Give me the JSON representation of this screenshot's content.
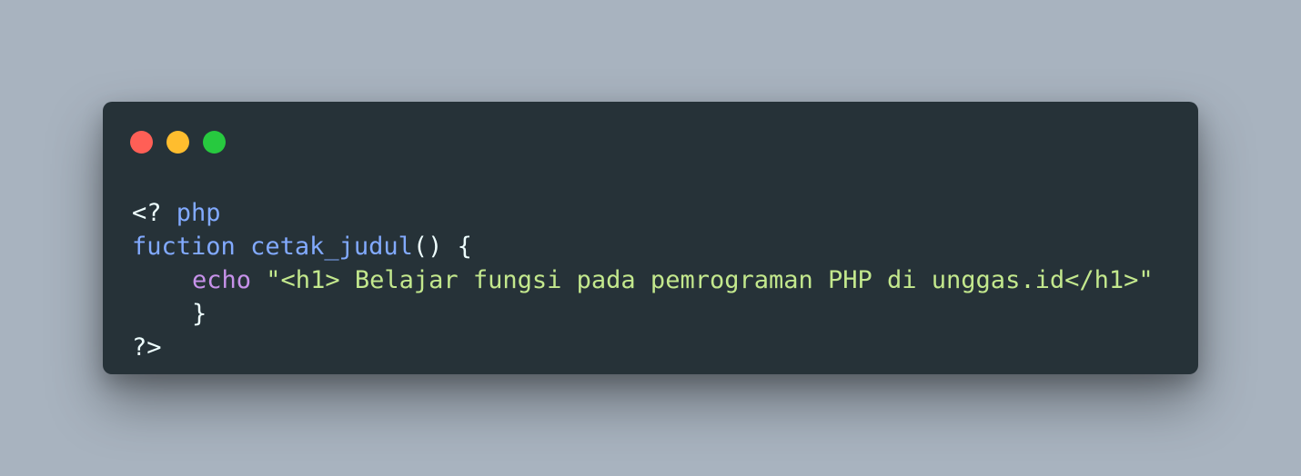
{
  "colors": {
    "background": "#a8b3bf",
    "window": "#263238",
    "plain": "#eeffff",
    "keyword": "#82aaff",
    "echo": "#c792ea",
    "string": "#c3e88d",
    "close": "#ff5f56",
    "minimize": "#ffbd2e",
    "maximize": "#27c93f"
  },
  "window_controls": {
    "close": "close",
    "minimize": "minimize",
    "maximize": "maximize"
  },
  "code": {
    "line1": {
      "open_tag": "<?",
      "space": " ",
      "php": "php"
    },
    "line2": {
      "fuction": "fuction",
      "space": " ",
      "name": "cetak_judul",
      "paren": "()",
      "brace": " {"
    },
    "line3": {
      "echo": "echo",
      "space": " ",
      "string": "\"<h1> Belajar fungsi pada pemrograman PHP di unggas.id</h1>\""
    },
    "line4": {
      "close_brace": "}"
    },
    "line5": {
      "close_tag": "?>"
    }
  }
}
